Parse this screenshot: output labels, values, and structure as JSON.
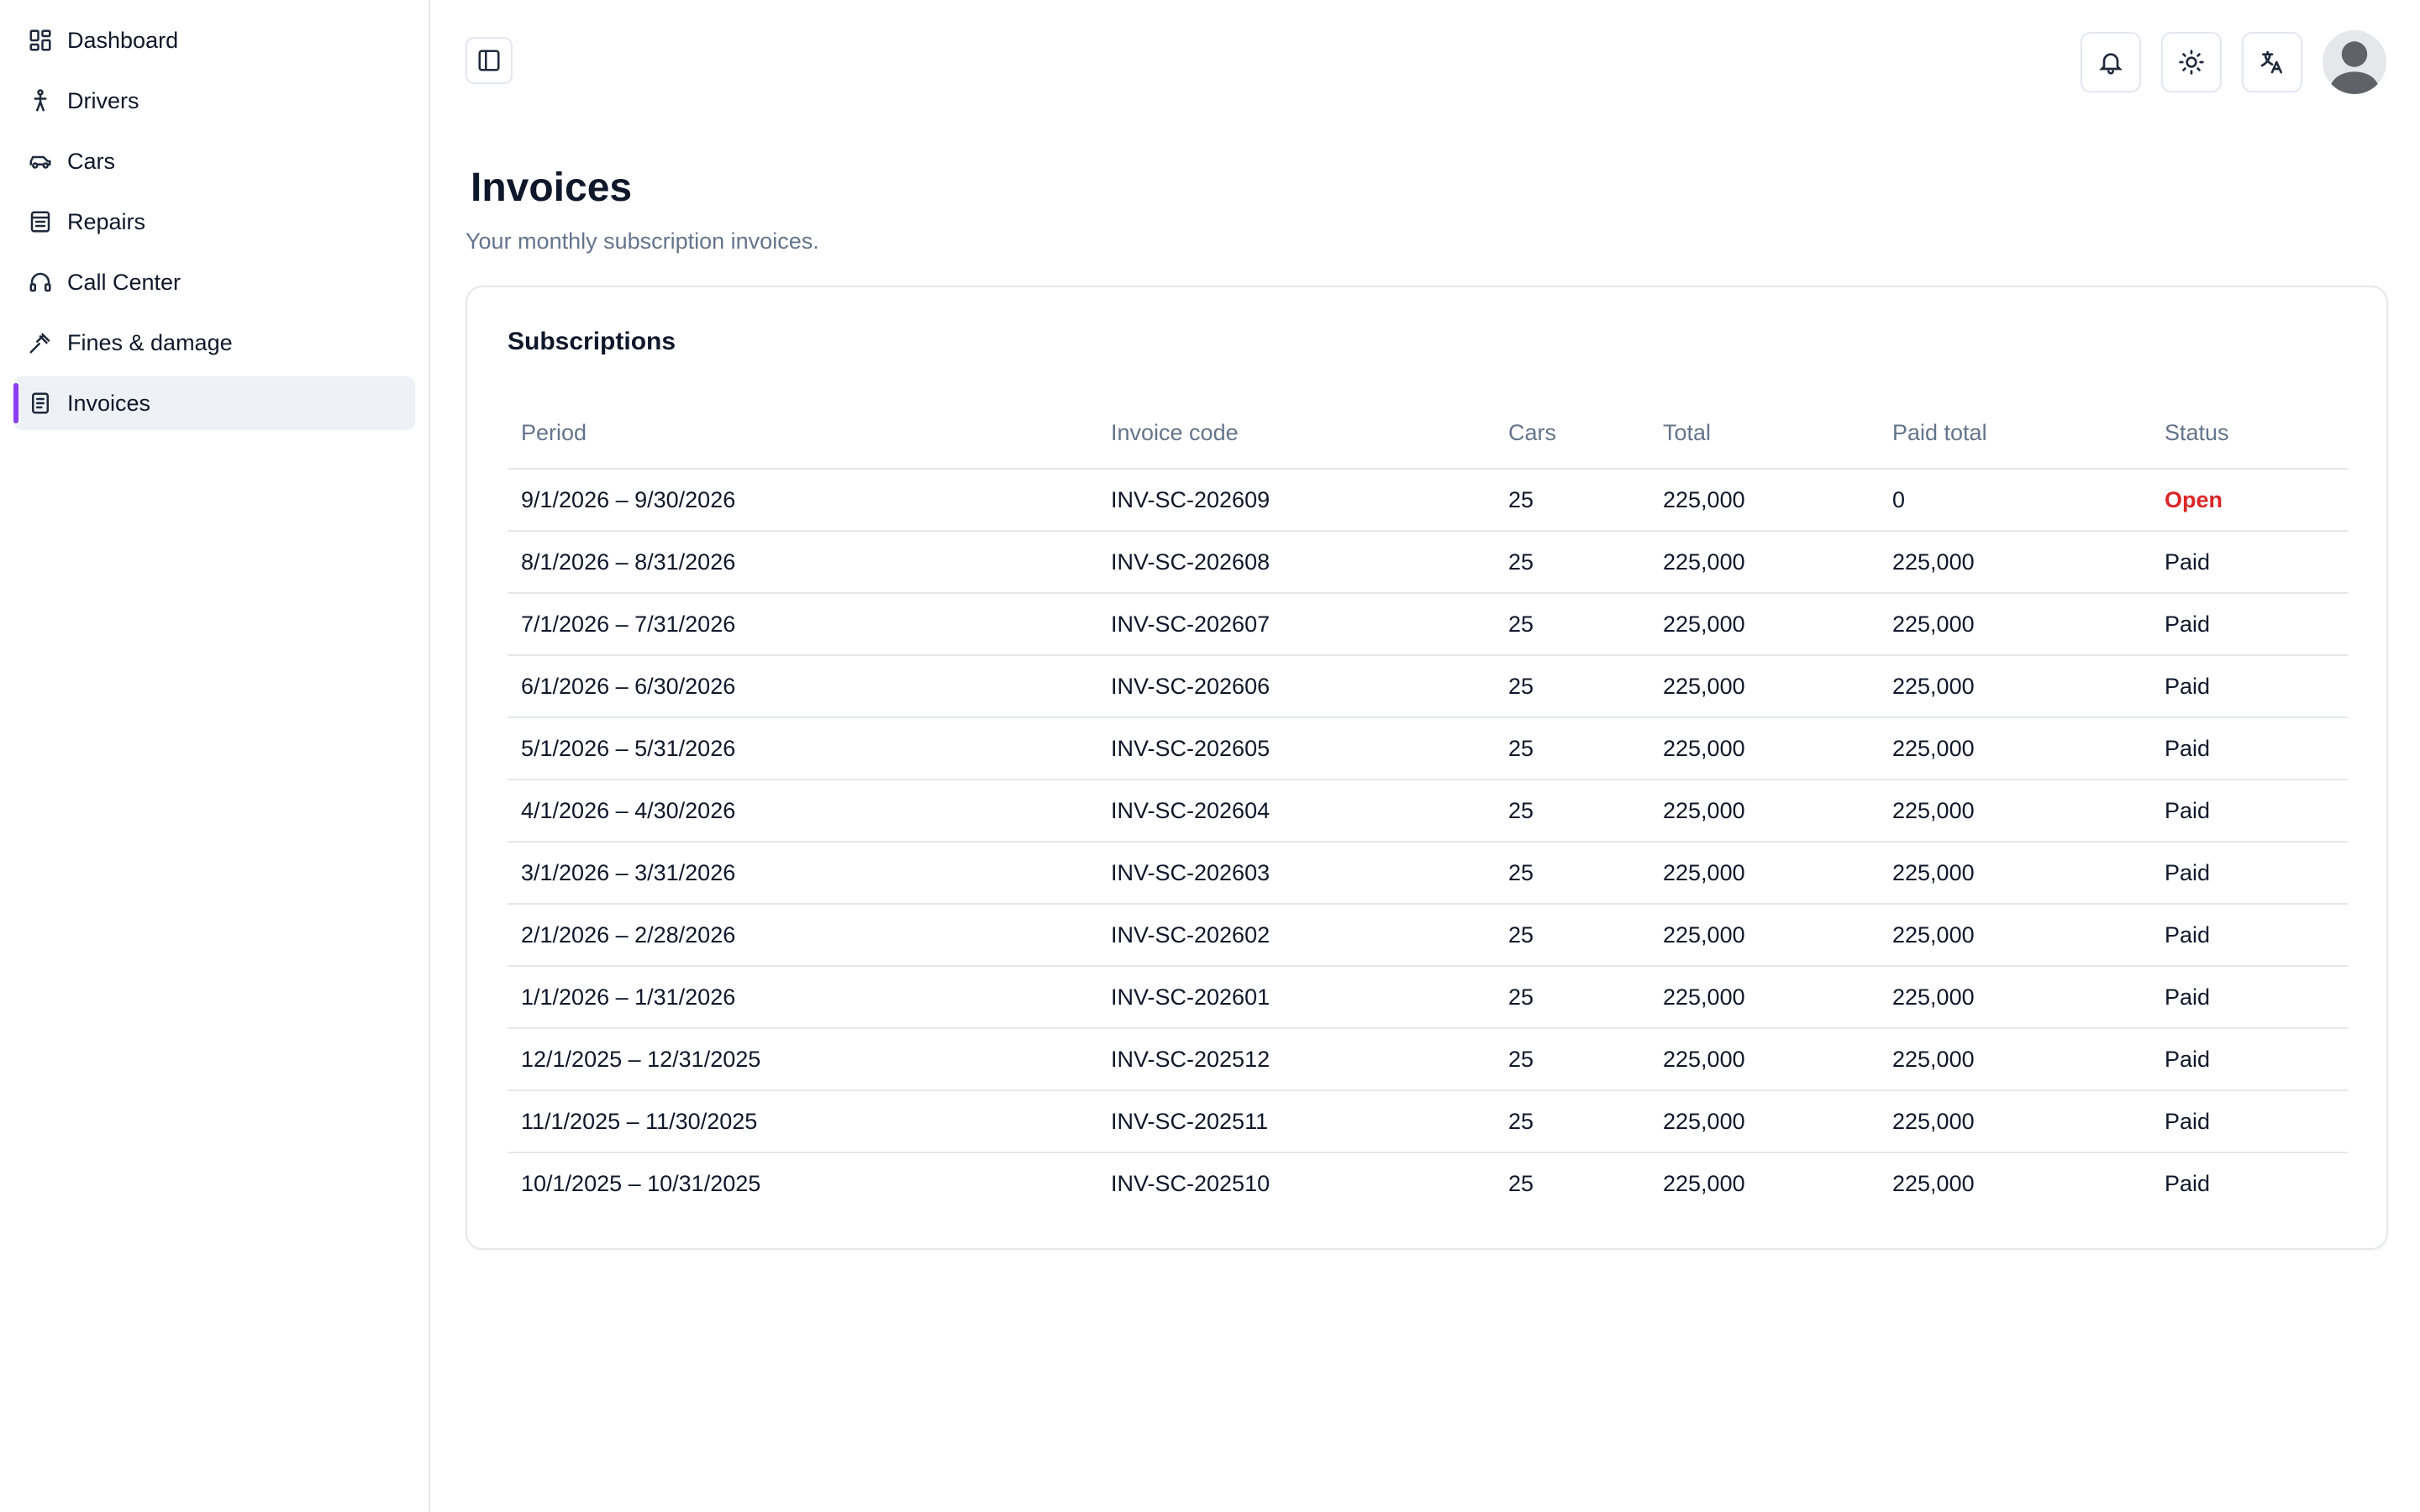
{
  "colors": {
    "accent": "#8b3df5",
    "open": "#dc2626"
  },
  "sidebar": {
    "items": [
      {
        "label": "Dashboard",
        "icon": "dashboard-grid-icon",
        "active": false
      },
      {
        "label": "Drivers",
        "icon": "person-walking-icon",
        "active": false
      },
      {
        "label": "Cars",
        "icon": "car-icon",
        "active": false
      },
      {
        "label": "Repairs",
        "icon": "repair-icon",
        "active": false
      },
      {
        "label": "Call Center",
        "icon": "headset-icon",
        "active": false
      },
      {
        "label": "Fines & damage",
        "icon": "gavel-icon",
        "active": false
      },
      {
        "label": "Invoices",
        "icon": "invoice-icon",
        "active": true
      }
    ]
  },
  "topbar": {
    "toggle_icon": "sidebar-toggle-icon",
    "actions": [
      "bell-icon",
      "sun-icon",
      "translate-icon",
      "avatar"
    ]
  },
  "page": {
    "title": "Invoices",
    "subtitle": "Your monthly subscription invoices."
  },
  "card": {
    "title": "Subscriptions",
    "columns": [
      "Period",
      "Invoice code",
      "Cars",
      "Total",
      "Paid total",
      "Status"
    ],
    "rows": [
      {
        "period": "9/1/2026 – 9/30/2026",
        "code": "INV-SC-202609",
        "cars": "25",
        "total": "225,000",
        "paid": "0",
        "status": "Open"
      },
      {
        "period": "8/1/2026 – 8/31/2026",
        "code": "INV-SC-202608",
        "cars": "25",
        "total": "225,000",
        "paid": "225,000",
        "status": "Paid"
      },
      {
        "period": "7/1/2026 – 7/31/2026",
        "code": "INV-SC-202607",
        "cars": "25",
        "total": "225,000",
        "paid": "225,000",
        "status": "Paid"
      },
      {
        "period": "6/1/2026 – 6/30/2026",
        "code": "INV-SC-202606",
        "cars": "25",
        "total": "225,000",
        "paid": "225,000",
        "status": "Paid"
      },
      {
        "period": "5/1/2026 – 5/31/2026",
        "code": "INV-SC-202605",
        "cars": "25",
        "total": "225,000",
        "paid": "225,000",
        "status": "Paid"
      },
      {
        "period": "4/1/2026 – 4/30/2026",
        "code": "INV-SC-202604",
        "cars": "25",
        "total": "225,000",
        "paid": "225,000",
        "status": "Paid"
      },
      {
        "period": "3/1/2026 – 3/31/2026",
        "code": "INV-SC-202603",
        "cars": "25",
        "total": "225,000",
        "paid": "225,000",
        "status": "Paid"
      },
      {
        "period": "2/1/2026 – 2/28/2026",
        "code": "INV-SC-202602",
        "cars": "25",
        "total": "225,000",
        "paid": "225,000",
        "status": "Paid"
      },
      {
        "period": "1/1/2026 – 1/31/2026",
        "code": "INV-SC-202601",
        "cars": "25",
        "total": "225,000",
        "paid": "225,000",
        "status": "Paid"
      },
      {
        "period": "12/1/2025 – 12/31/2025",
        "code": "INV-SC-202512",
        "cars": "25",
        "total": "225,000",
        "paid": "225,000",
        "status": "Paid"
      },
      {
        "period": "11/1/2025 – 11/30/2025",
        "code": "INV-SC-202511",
        "cars": "25",
        "total": "225,000",
        "paid": "225,000",
        "status": "Paid"
      },
      {
        "period": "10/1/2025 – 10/31/2025",
        "code": "INV-SC-202510",
        "cars": "25",
        "total": "225,000",
        "paid": "225,000",
        "status": "Paid"
      }
    ]
  }
}
